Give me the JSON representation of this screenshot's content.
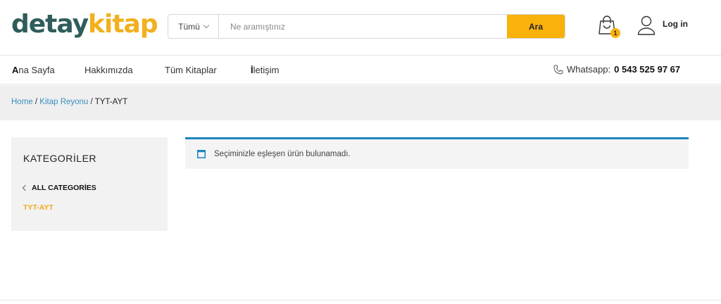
{
  "header": {
    "logo_part1": "detay",
    "logo_part2": "kitap",
    "search": {
      "category": "Tümü",
      "placeholder": "Ne aramıştınız",
      "value": "",
      "button": "Ara"
    },
    "cart_count": "1",
    "login_label": "Log in"
  },
  "nav": {
    "items": [
      {
        "first": "A",
        "rest": "na Sayfa"
      },
      {
        "first": "",
        "rest": "Hakkımızda"
      },
      {
        "first": "",
        "rest": "Tüm Kitaplar"
      },
      {
        "first": "İ",
        "rest": "letişim"
      }
    ],
    "phone_label": "Whatsapp:",
    "phone_number": "0 543 525 97 67"
  },
  "breadcrumb": {
    "home": "Home",
    "sep": " / ",
    "section": "Kitap Reyonu",
    "current": "TYT-AYT"
  },
  "sidebar": {
    "title": "KATEGORİLER",
    "all_categories": "ALL CATEGORİES",
    "current": "TYT-AYT"
  },
  "notice": {
    "text": "Seçiminizle eşleşen ürün bulunamadı."
  },
  "colors": {
    "accent": "#f9b10b",
    "logo_dark": "#2f5d5a",
    "link": "#3b8fc0",
    "notice_border": "#1e85be"
  }
}
